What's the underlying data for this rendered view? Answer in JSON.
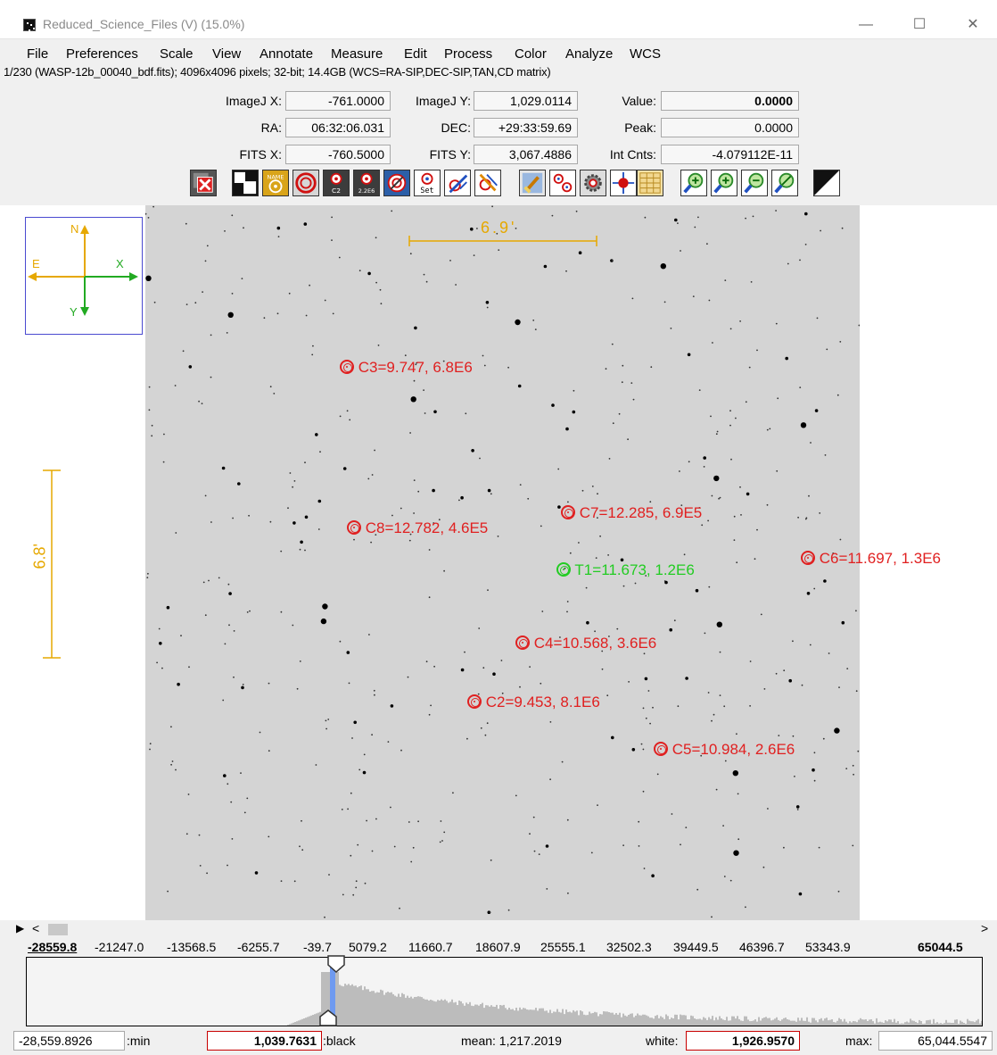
{
  "window": {
    "title": "Reduced_Science_Files (V) (15.0%)",
    "minimize": "—",
    "maximize": "☐",
    "close": "✕"
  },
  "menu": [
    "File",
    "Preferences",
    "Scale",
    "View",
    "Annotate",
    "Measure",
    "Edit",
    "Process",
    "Color",
    "Analyze",
    "WCS"
  ],
  "info_line": "1/230 (WASP-12b_00040_bdf.fits); 4096x4096 pixels; 32-bit; 14.4GB (WCS=RA-SIP,DEC-SIP,TAN,CD matrix)",
  "readouts": {
    "imagej_x_label": "ImageJ X:",
    "imagej_x": "-761.0000",
    "imagej_y_label": "ImageJ Y:",
    "imagej_y": "1,029.0114",
    "value_label": "Value:",
    "value": "0.0000",
    "ra_label": "RA:",
    "ra": "06:32:06.031",
    "dec_label": "DEC:",
    "dec": "+29:33:59.69",
    "peak_label": "Peak:",
    "peak": "0.0000",
    "fits_x_label": "FITS X:",
    "fits_x": "-760.5000",
    "fits_y_label": "FITS Y:",
    "fits_y": "3,067.4886",
    "int_cnts_label": "Int Cnts:",
    "int_cnts": "-4.079112E-11"
  },
  "toolbar": {
    "name_label": "NAME",
    "c2_label": "C2",
    "centroid_label": "2.2E6",
    "set_label": "Set",
    "icons": [
      "clear-overlay-icon",
      "invert-icon",
      "show-names-icon",
      "aperture-icon",
      "aperture-label-icon",
      "aperture-counts-icon",
      "centroid-icon",
      "set-aperture-icon",
      "remove-stars-icon",
      "multi-aperture-icon",
      "broom-icon",
      "multi-aperture-2-icon",
      "gear-stars-icon",
      "crosshair-icon",
      "table-icon",
      "zoom-in-icon",
      "zoom-in-alt-icon",
      "zoom-out-icon",
      "zoom-fit-icon",
      "contrast-icon"
    ]
  },
  "compass": {
    "north": "N",
    "east": "E",
    "x": "X",
    "y": "Y"
  },
  "scale_bars": {
    "horizontal": "6.9'",
    "vertical": "6.8'"
  },
  "apertures": [
    {
      "name": "C3",
      "label": "C3=9.747, 6.8E6",
      "color": "#e02020"
    },
    {
      "name": "C8",
      "label": "C8=12.782, 4.6E5",
      "color": "#e02020"
    },
    {
      "name": "C7",
      "label": "C7=12.285, 6.9E5",
      "color": "#e02020"
    },
    {
      "name": "T1",
      "label": "T1=11.673, 1.2E6",
      "color": "#22cc22"
    },
    {
      "name": "C6",
      "label": "C6=11.697, 1.3E6",
      "color": "#e02020"
    },
    {
      "name": "C4",
      "label": "C4=10.568, 3.6E6",
      "color": "#e02020"
    },
    {
      "name": "C2",
      "label": "C2=9.453, 8.1E6",
      "color": "#e02020"
    },
    {
      "name": "C5",
      "label": "C5=10.984, 2.6E6",
      "color": "#e02020"
    }
  ],
  "histogram": {
    "ticks": [
      "-28559.8",
      "-21247.0",
      "-13568.5",
      "-6255.7",
      "-39.7",
      "5079.2",
      "11660.7",
      "18607.9",
      "25555.1",
      "32502.3",
      "39449.5",
      "46396.7",
      "53343.9",
      "65044.5"
    ]
  },
  "status": {
    "min_value": "-28,559.8926",
    "min_label": ":min",
    "black_value": "1,039.7631",
    "black_label": ":black",
    "mean": "mean: 1,217.2019",
    "white_label": "white:",
    "white_value": "1,926.9570",
    "max_label": "max:",
    "max_value": "65,044.5547"
  },
  "colors": {
    "aperture_red": "#e02020",
    "target_green": "#22cc22",
    "scale_orange": "#e6a800",
    "compass_frame": "#4a4ad0"
  }
}
